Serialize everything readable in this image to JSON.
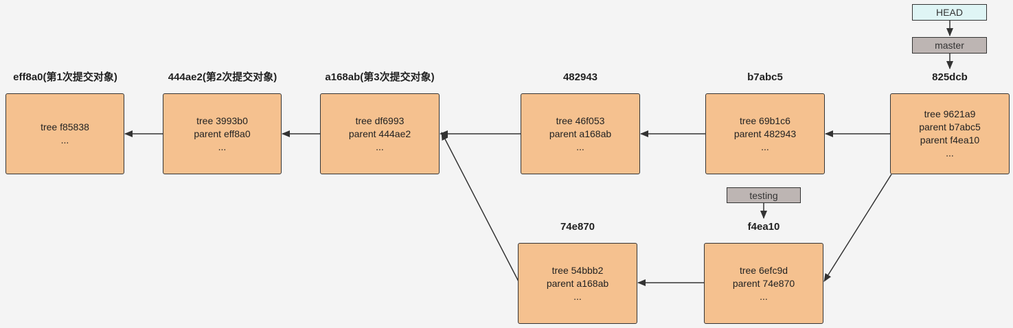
{
  "refs": {
    "head": "HEAD",
    "master": "master",
    "testing": "testing"
  },
  "commits": {
    "eff8a0": {
      "title": "eff8a0(第1次提交对象)",
      "lines": [
        "tree f85838",
        "..."
      ]
    },
    "c444ae2": {
      "title": "444ae2(第2次提交对象)",
      "lines": [
        "tree 3993b0",
        "parent eff8a0",
        "..."
      ]
    },
    "a168ab": {
      "title": "a168ab(第3次提交对象)",
      "lines": [
        "tree df6993",
        "parent 444ae2",
        "..."
      ]
    },
    "c482943": {
      "title": "482943",
      "lines": [
        "tree 46f053",
        "parent a168ab",
        "..."
      ]
    },
    "b7abc5": {
      "title": "b7abc5",
      "lines": [
        "tree 69b1c6",
        "parent 482943",
        "..."
      ]
    },
    "c825dcb": {
      "title": "825dcb",
      "lines": [
        "tree 9621a9",
        "parent b7abc5",
        "parent f4ea10",
        "..."
      ]
    },
    "c74e870": {
      "title": "74e870",
      "lines": [
        "tree 54bbb2",
        "parent a168ab",
        "..."
      ]
    },
    "f4ea10": {
      "title": "f4ea10",
      "lines": [
        "tree 6efc9d",
        "parent 74e870",
        "..."
      ]
    }
  },
  "colors": {
    "commit_fill": "#f5c18f",
    "head_fill": "#dff5f5",
    "branch_fill": "#bdb5b3",
    "background": "#f4f4f4",
    "line": "#333333"
  }
}
